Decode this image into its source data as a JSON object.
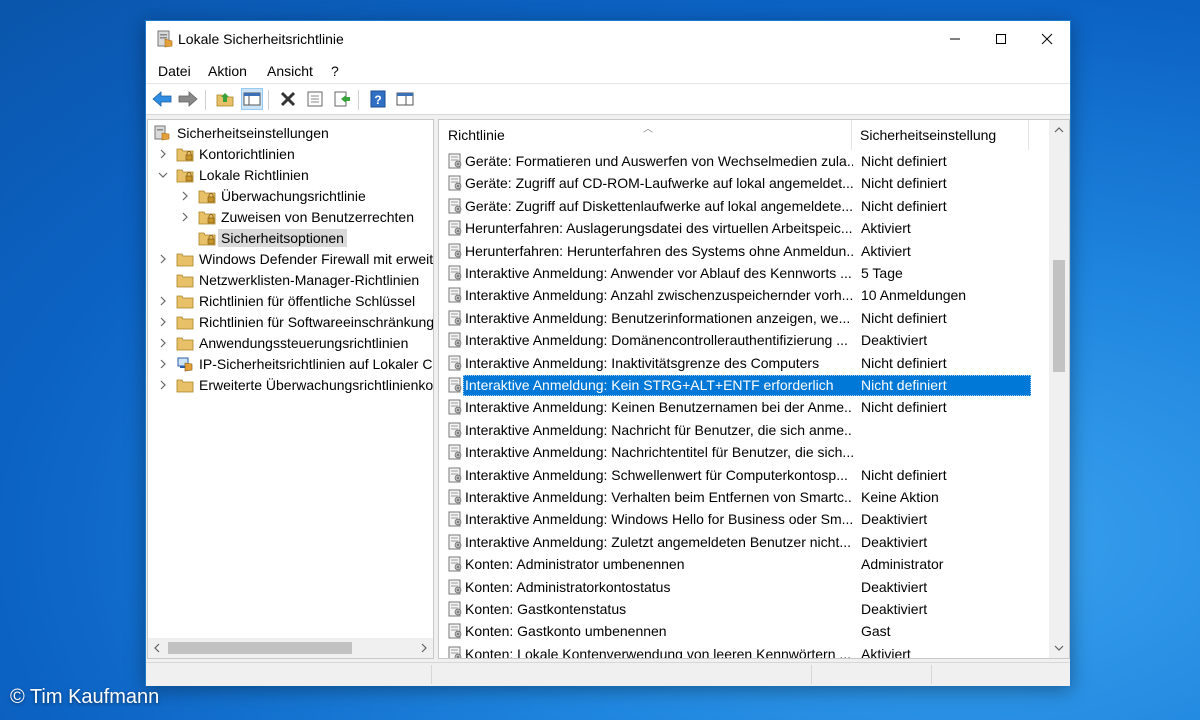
{
  "window": {
    "title": "Lokale Sicherheitsrichtlinie"
  },
  "menu": [
    "Datei",
    "Aktion",
    "Ansicht",
    "?"
  ],
  "toolbar": {
    "buttons": [
      "back-icon",
      "forward-icon",
      "up-folder-icon",
      "show-hide-tree-icon",
      "delete-icon",
      "properties-icon",
      "export-list-icon",
      "help-icon",
      "view-icon"
    ]
  },
  "tree": {
    "root": "Sicherheitseinstellungen",
    "items": [
      {
        "label": "Kontorichtlinien"
      },
      {
        "label": "Lokale Richtlinien"
      },
      {
        "label": "Überwachungsrichtlinie"
      },
      {
        "label": "Zuweisen von Benutzerrechten"
      },
      {
        "label": "Sicherheitsoptionen"
      },
      {
        "label": "Windows Defender Firewall mit erweite"
      },
      {
        "label": "Netzwerklisten-Manager-Richtlinien"
      },
      {
        "label": "Richtlinien für öffentliche Schlüssel"
      },
      {
        "label": "Richtlinien für Softwareeinschränkung"
      },
      {
        "label": "Anwendungssteuerungsrichtlinien"
      },
      {
        "label": "IP-Sicherheitsrichtlinien auf Lokaler Cc"
      },
      {
        "label": "Erweiterte Überwachungsrichtlinienko"
      }
    ]
  },
  "list": {
    "columns": [
      "Richtlinie",
      "Sicherheitseinstellung"
    ],
    "rows": [
      {
        "policy": "Geräte: Formatieren und Auswerfen von Wechselmedien zula...",
        "setting": "Nicht definiert"
      },
      {
        "policy": "Geräte: Zugriff auf CD-ROM-Laufwerke auf lokal angemeldet...",
        "setting": "Nicht definiert"
      },
      {
        "policy": "Geräte: Zugriff auf Diskettenlaufwerke auf lokal angemeldete...",
        "setting": "Nicht definiert"
      },
      {
        "policy": "Herunterfahren: Auslagerungsdatei des virtuellen Arbeitspeic...",
        "setting": "Aktiviert"
      },
      {
        "policy": "Herunterfahren: Herunterfahren des Systems ohne Anmeldun...",
        "setting": "Aktiviert"
      },
      {
        "policy": "Interaktive Anmeldung: Anwender vor Ablauf des Kennworts ...",
        "setting": "5 Tage"
      },
      {
        "policy": "Interaktive Anmeldung: Anzahl zwischenzuspeichernder vorh...",
        "setting": "10 Anmeldungen"
      },
      {
        "policy": "Interaktive Anmeldung: Benutzerinformationen anzeigen, we...",
        "setting": "Nicht definiert"
      },
      {
        "policy": "Interaktive Anmeldung: Domänencontrollerauthentifizierung ...",
        "setting": "Deaktiviert"
      },
      {
        "policy": "Interaktive Anmeldung: Inaktivitätsgrenze des Computers",
        "setting": "Nicht definiert"
      },
      {
        "policy": "Interaktive Anmeldung: Kein STRG+ALT+ENTF erforderlich",
        "setting": "Nicht definiert"
      },
      {
        "policy": "Interaktive Anmeldung: Keinen Benutzernamen bei der Anme...",
        "setting": "Nicht definiert"
      },
      {
        "policy": "Interaktive Anmeldung: Nachricht für Benutzer, die sich anme...",
        "setting": ""
      },
      {
        "policy": "Interaktive Anmeldung: Nachrichtentitel für Benutzer, die sich...",
        "setting": ""
      },
      {
        "policy": "Interaktive Anmeldung: Schwellenwert für Computerkontosp...",
        "setting": "Nicht definiert"
      },
      {
        "policy": "Interaktive Anmeldung: Verhalten beim Entfernen von Smartc...",
        "setting": "Keine Aktion"
      },
      {
        "policy": "Interaktive Anmeldung: Windows Hello for Business oder Sm...",
        "setting": "Deaktiviert"
      },
      {
        "policy": "Interaktive Anmeldung: Zuletzt angemeldeten Benutzer nicht...",
        "setting": "Deaktiviert"
      },
      {
        "policy": "Konten: Administrator umbenennen",
        "setting": "Administrator"
      },
      {
        "policy": "Konten: Administratorkontostatus",
        "setting": "Deaktiviert"
      },
      {
        "policy": "Konten: Gastkontenstatus",
        "setting": "Deaktiviert"
      },
      {
        "policy": "Konten: Gastkonto umbenennen",
        "setting": "Gast"
      },
      {
        "policy": "Konten: Lokale Kontenverwendung von leeren Kennwörtern ...",
        "setting": "Aktiviert"
      }
    ],
    "selected_policy": "Interaktive Anmeldung: Kein STRG+ALT+ENTF erforderlich"
  },
  "credit": "© Tim Kaufmann",
  "colors": {
    "selection": "#0078d7",
    "folder": "#e8c068",
    "desktop": "#1f86df"
  }
}
